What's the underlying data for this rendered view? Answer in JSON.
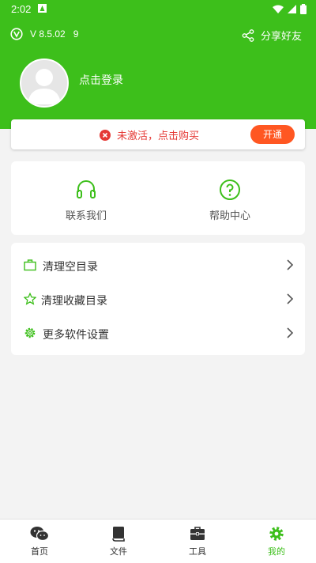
{
  "status_bar": {
    "time": "2:02"
  },
  "header": {
    "version": "V 8.5.02   9",
    "share_label": "分享好友",
    "login_label": "点击登录"
  },
  "activation": {
    "message": "未激活，点击购买",
    "button_label": "开通"
  },
  "help": {
    "items": [
      {
        "label": "联系我们",
        "icon": "headset-icon"
      },
      {
        "label": "帮助中心",
        "icon": "help-circle-icon"
      }
    ]
  },
  "menu": {
    "items": [
      {
        "label": "清理空目录",
        "icon": "briefcase-icon"
      },
      {
        "label": "清理收藏目录",
        "icon": "star-icon"
      },
      {
        "label": "更多软件设置",
        "icon": "gear-icon"
      }
    ]
  },
  "tabbar": {
    "items": [
      {
        "label": "首页",
        "icon": "chat-icon"
      },
      {
        "label": "文件",
        "icon": "book-icon"
      },
      {
        "label": "工具",
        "icon": "toolbox-icon"
      },
      {
        "label": "我的",
        "icon": "gear-icon"
      }
    ],
    "active_index": 3
  },
  "colors": {
    "brand": "#3dbf1b",
    "alert": "#e53935",
    "action": "#ff5722"
  }
}
